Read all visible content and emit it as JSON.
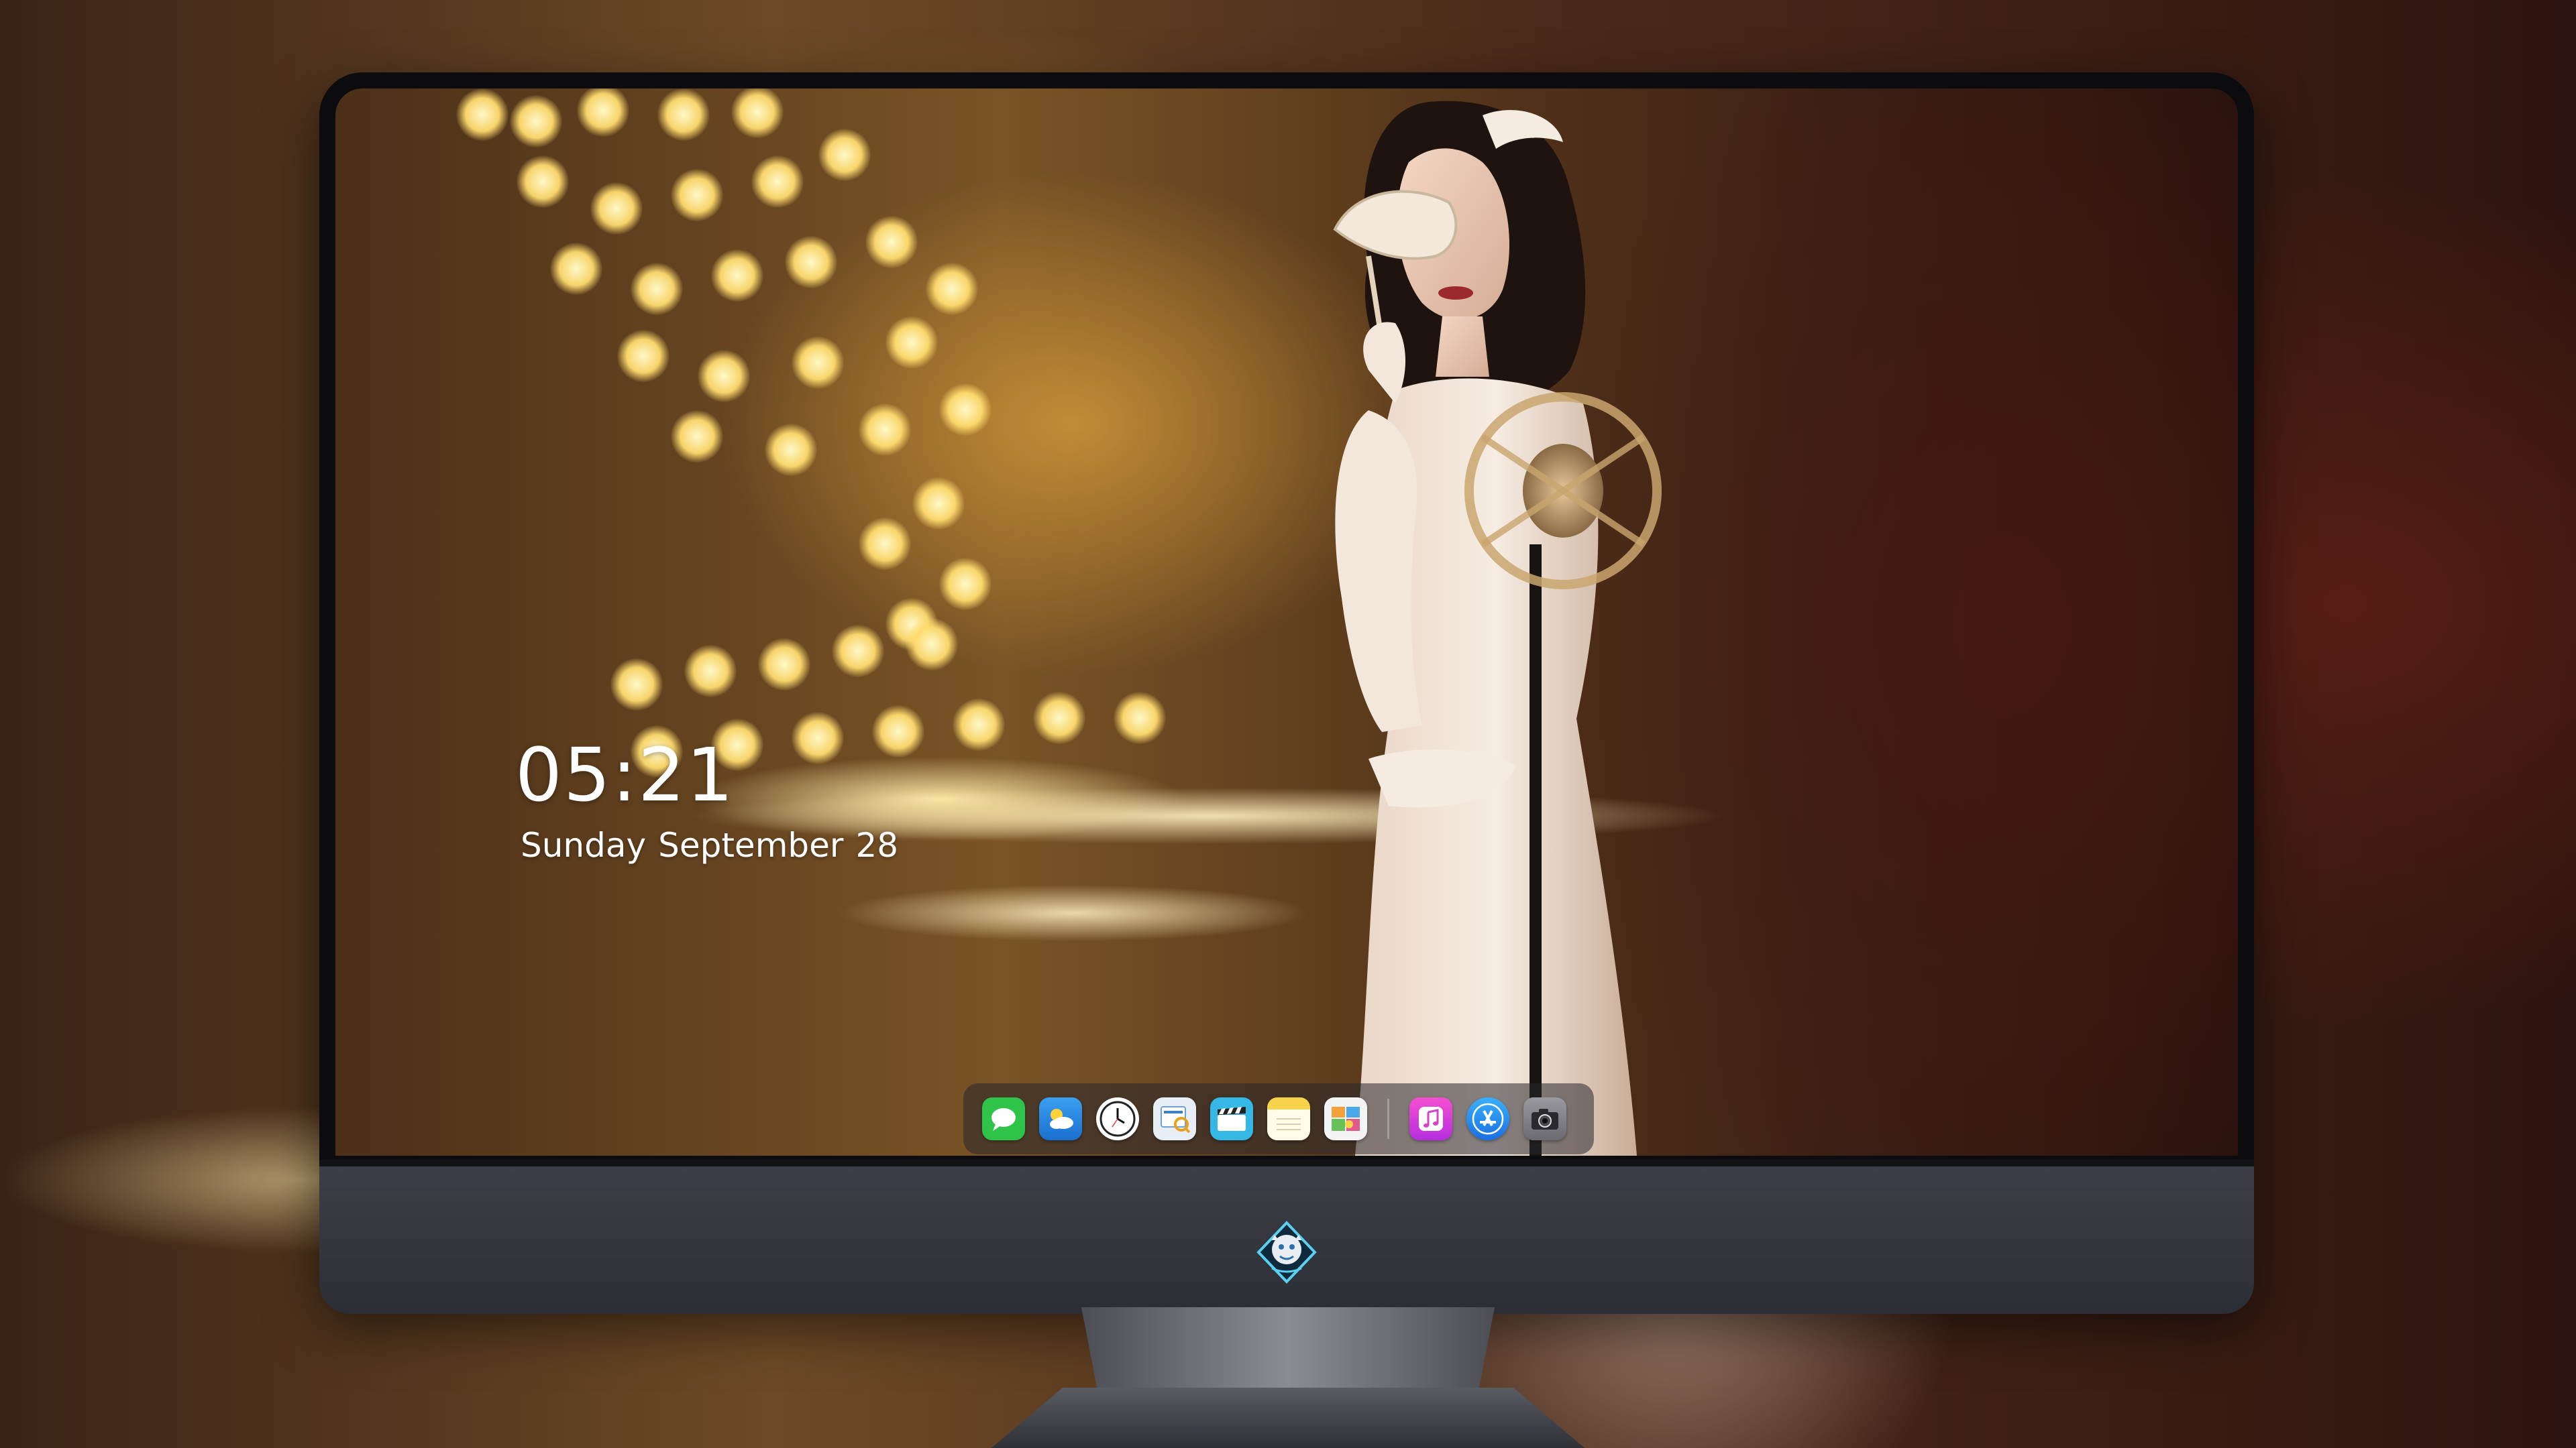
{
  "lockscreen": {
    "time": "05:21",
    "date_day": "Sunday",
    "date_month": "September",
    "date_number": "28"
  },
  "dock": {
    "apps": [
      {
        "name": "messages-icon",
        "color": "#2fc34a"
      },
      {
        "name": "weather-icon",
        "color": "#2a8de8"
      },
      {
        "name": "clock-icon",
        "color": "#f2f2f2"
      },
      {
        "name": "preview-icon",
        "color": "#e8eef6"
      },
      {
        "name": "clapper-icon",
        "color": "#35b8e6"
      },
      {
        "name": "notes-icon",
        "color": "#f7d24a"
      },
      {
        "name": "photos-collage-icon",
        "color": "#f4f4f4"
      },
      {
        "name": "music-icon",
        "color": "#d641c8"
      },
      {
        "name": "app-store-icon",
        "color": "#1e8df0"
      },
      {
        "name": "camera-icon",
        "color": "#8a8a90"
      }
    ]
  },
  "monitor": {
    "badge_icon": "dragon-logo-icon",
    "bezel_color": "#0c0c0e",
    "chin_color": "#383a42"
  }
}
